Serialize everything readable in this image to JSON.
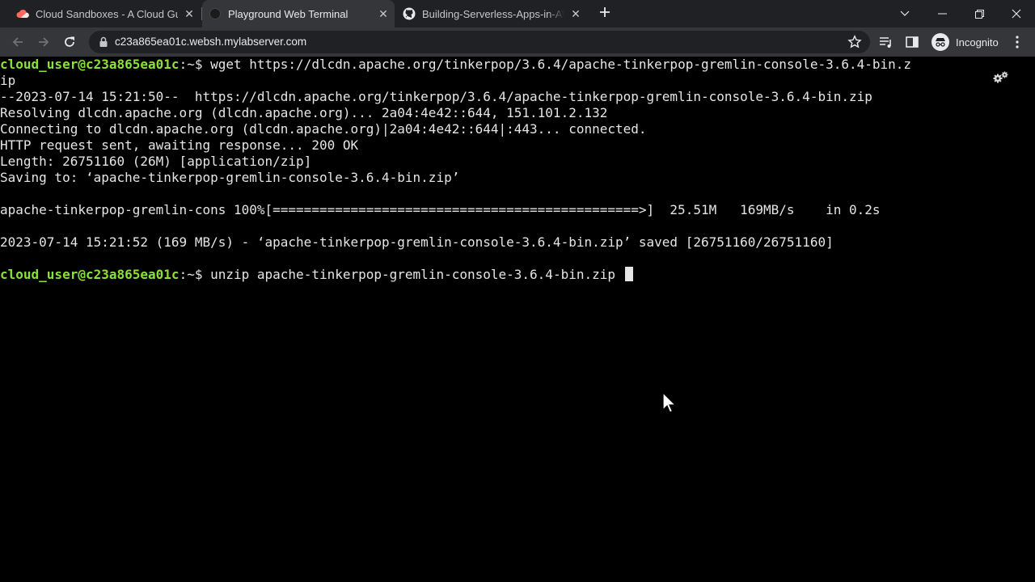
{
  "tabs": [
    {
      "title": "Cloud Sandboxes - A Cloud Guru",
      "icon": "acg-cloud-icon",
      "active": false
    },
    {
      "title": "Playground Web Terminal",
      "icon": "terminal-icon",
      "active": true
    },
    {
      "title": "Building-Serverless-Apps-in-AWS",
      "icon": "github-icon",
      "active": false
    }
  ],
  "toolbar": {
    "url": "c23a865ea01c.websh.mylabserver.com",
    "profile_label": "Incognito"
  },
  "terminal": {
    "prompt": "cloud_user@c23a865ea01c",
    "prompt_suffix": ":~$ ",
    "command1": "wget https://dlcdn.apache.org/tinkerpop/3.6.4/apache-tinkerpop-gremlin-console-3.6.4-bin.z",
    "command1_wrap": "ip",
    "output": [
      "--2023-07-14 15:21:50--  https://dlcdn.apache.org/tinkerpop/3.6.4/apache-tinkerpop-gremlin-console-3.6.4-bin.zip",
      "Resolving dlcdn.apache.org (dlcdn.apache.org)... 2a04:4e42::644, 151.101.2.132",
      "Connecting to dlcdn.apache.org (dlcdn.apache.org)|2a04:4e42::644|:443... connected.",
      "HTTP request sent, awaiting response... 200 OK",
      "Length: 26751160 (26M) [application/zip]",
      "Saving to: ‘apache-tinkerpop-gremlin-console-3.6.4-bin.zip’",
      "",
      "apache-tinkerpop-gremlin-cons 100%[===============================================>]  25.51M   169MB/s    in 0.2s",
      "",
      "2023-07-14 15:21:52 (169 MB/s) - ‘apache-tinkerpop-gremlin-console-3.6.4-bin.zip’ saved [26751160/26751160]",
      ""
    ],
    "command2": "unzip apache-tinkerpop-gremlin-console-3.6.4-bin.zip "
  },
  "colors": {
    "prompt": "#8ae234",
    "text": "#e5e5e5",
    "background": "#000000",
    "tabstrip": "#202124",
    "active_tab": "#35363a"
  }
}
